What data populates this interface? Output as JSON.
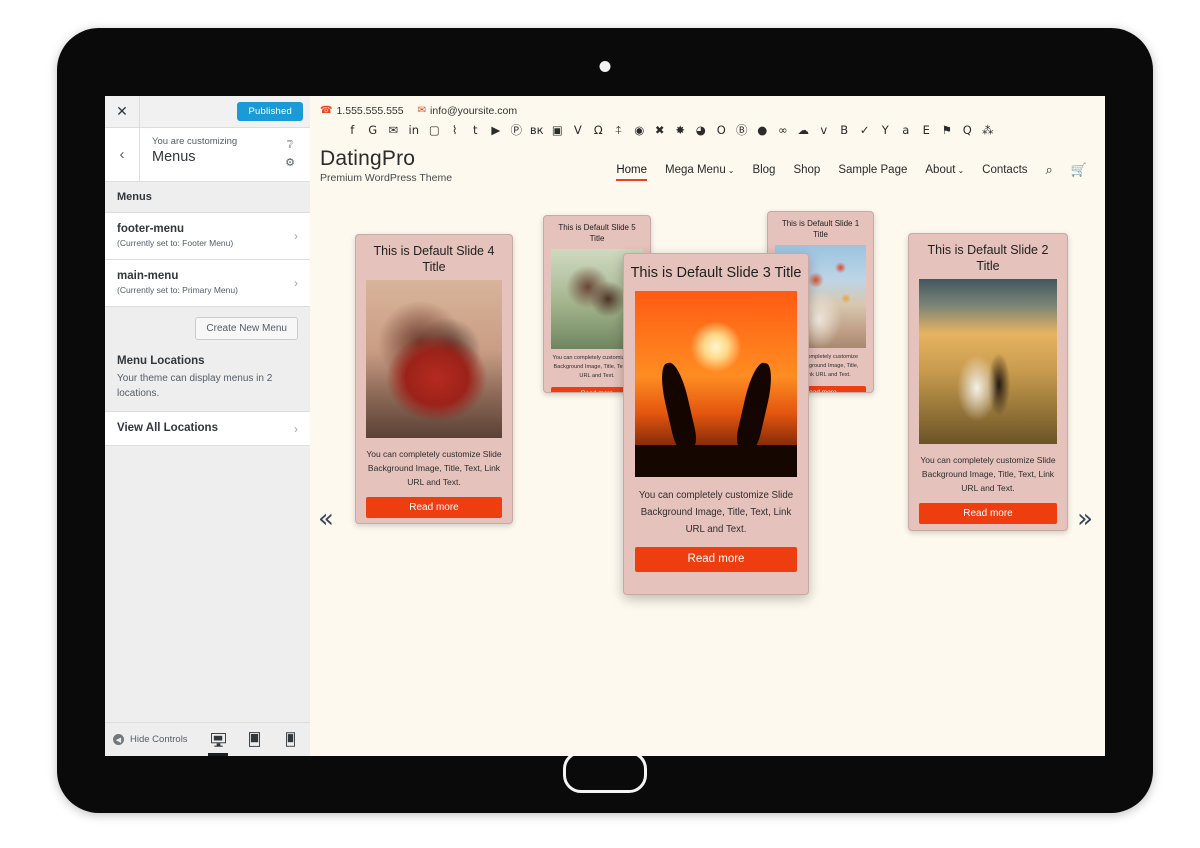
{
  "customizer": {
    "close_label": "✕",
    "publish_label": "Published",
    "back_label": "‹",
    "eyebrow": "You are customizing",
    "title": "Menus",
    "help_icon": "help-icon",
    "gear_icon": "gear-icon",
    "section_label": "Menus",
    "menus": [
      {
        "name": "footer-menu",
        "assigned": "(Currently set to: Footer Menu)"
      },
      {
        "name": "main-menu",
        "assigned": "(Currently set to: Primary Menu)"
      }
    ],
    "create_menu_label": "Create New Menu",
    "locations_title": "Menu Locations",
    "locations_desc": "Your theme can display menus in 2 locations.",
    "view_all_label": "View All Locations",
    "hide_controls_label": "Hide Controls",
    "devices": [
      {
        "name": "desktop",
        "glyph": "🖵",
        "active": true
      },
      {
        "name": "tablet",
        "glyph": "▯",
        "active": false
      },
      {
        "name": "mobile",
        "glyph": "▯",
        "active": false
      }
    ],
    "accent": "#1a9bd7"
  },
  "site": {
    "topbar": {
      "phone": "1.555.555.555",
      "email": "info@yoursite.com",
      "phone_icon": "phone-icon",
      "email_icon": "envelope-icon",
      "icon_color": "#e8441f",
      "social": [
        "facebook",
        "google-plus",
        "twitter",
        "linkedin",
        "instagram",
        "rss",
        "tumblr",
        "youtube",
        "pinterest",
        "vk",
        "flipboard",
        "vine",
        "github",
        "untappd",
        "dribbble",
        "xing",
        "snowflake",
        "meetup",
        "odnoklassniki",
        "behance",
        "opencart",
        "500px",
        "cloud",
        "vimeo",
        "blogger",
        "yelp",
        "yahoo",
        "amazon",
        "envato",
        "foursquare",
        "quora",
        "wikipedia"
      ]
    },
    "brand": {
      "name": "DatingPro",
      "tagline": "Premium WordPress Theme"
    },
    "nav": [
      {
        "label": "Home",
        "active": true,
        "caret": false
      },
      {
        "label": "Mega Menu",
        "active": false,
        "caret": true
      },
      {
        "label": "Blog",
        "active": false,
        "caret": false
      },
      {
        "label": "Shop",
        "active": false,
        "caret": false
      },
      {
        "label": "Sample Page",
        "active": false,
        "caret": false
      },
      {
        "label": "About",
        "active": false,
        "caret": true
      },
      {
        "label": "Contacts",
        "active": false,
        "caret": false
      }
    ],
    "nav_icons": [
      {
        "name": "search-icon",
        "glyph": "⌕"
      },
      {
        "name": "cart-icon",
        "glyph": "🛒"
      }
    ],
    "accent": "#e8441f",
    "button_color": "#ee3e10",
    "card_bg": "#e5c2bb",
    "page_bg": "#fdf9ef"
  },
  "slider": {
    "prev_label": "«",
    "next_label": "»",
    "body_text": "You can completely customize Slide Background Image, Title, Text, Link URL and Text.",
    "button_label": "Read more",
    "slides": [
      {
        "title": "This is Default Slide 4 Title"
      },
      {
        "title": "This is Default Slide 5 Title"
      },
      {
        "title": "This is Default Slide 3 Title"
      },
      {
        "title": "This is Default Slide 1 Title"
      },
      {
        "title": "This is Default Slide 2 Title"
      }
    ]
  }
}
